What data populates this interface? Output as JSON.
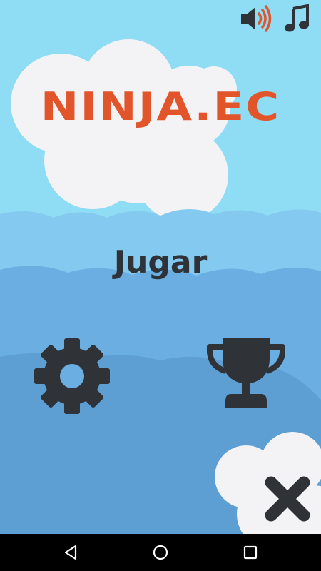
{
  "app": {
    "title": "NINJA.EC",
    "play_label": "Jugar"
  },
  "icons": {
    "sound": "speaker-icon",
    "music": "music-note-icon",
    "settings": "gear-icon",
    "leaderboard": "trophy-icon",
    "exit": "close-icon"
  },
  "system_nav": {
    "back": "back-triangle-icon",
    "home": "home-circle-icon",
    "recents": "recents-square-icon"
  },
  "colors": {
    "title": "#e2552a",
    "text_dark": "#2f3337",
    "sky_light": "#8fdcf5",
    "hill_1": "#84c9ef",
    "hill_2": "#6aaee2",
    "hill_3": "#5d9fd2",
    "cloud": "#f3f3f6",
    "sound_waves": "#e2552a"
  }
}
